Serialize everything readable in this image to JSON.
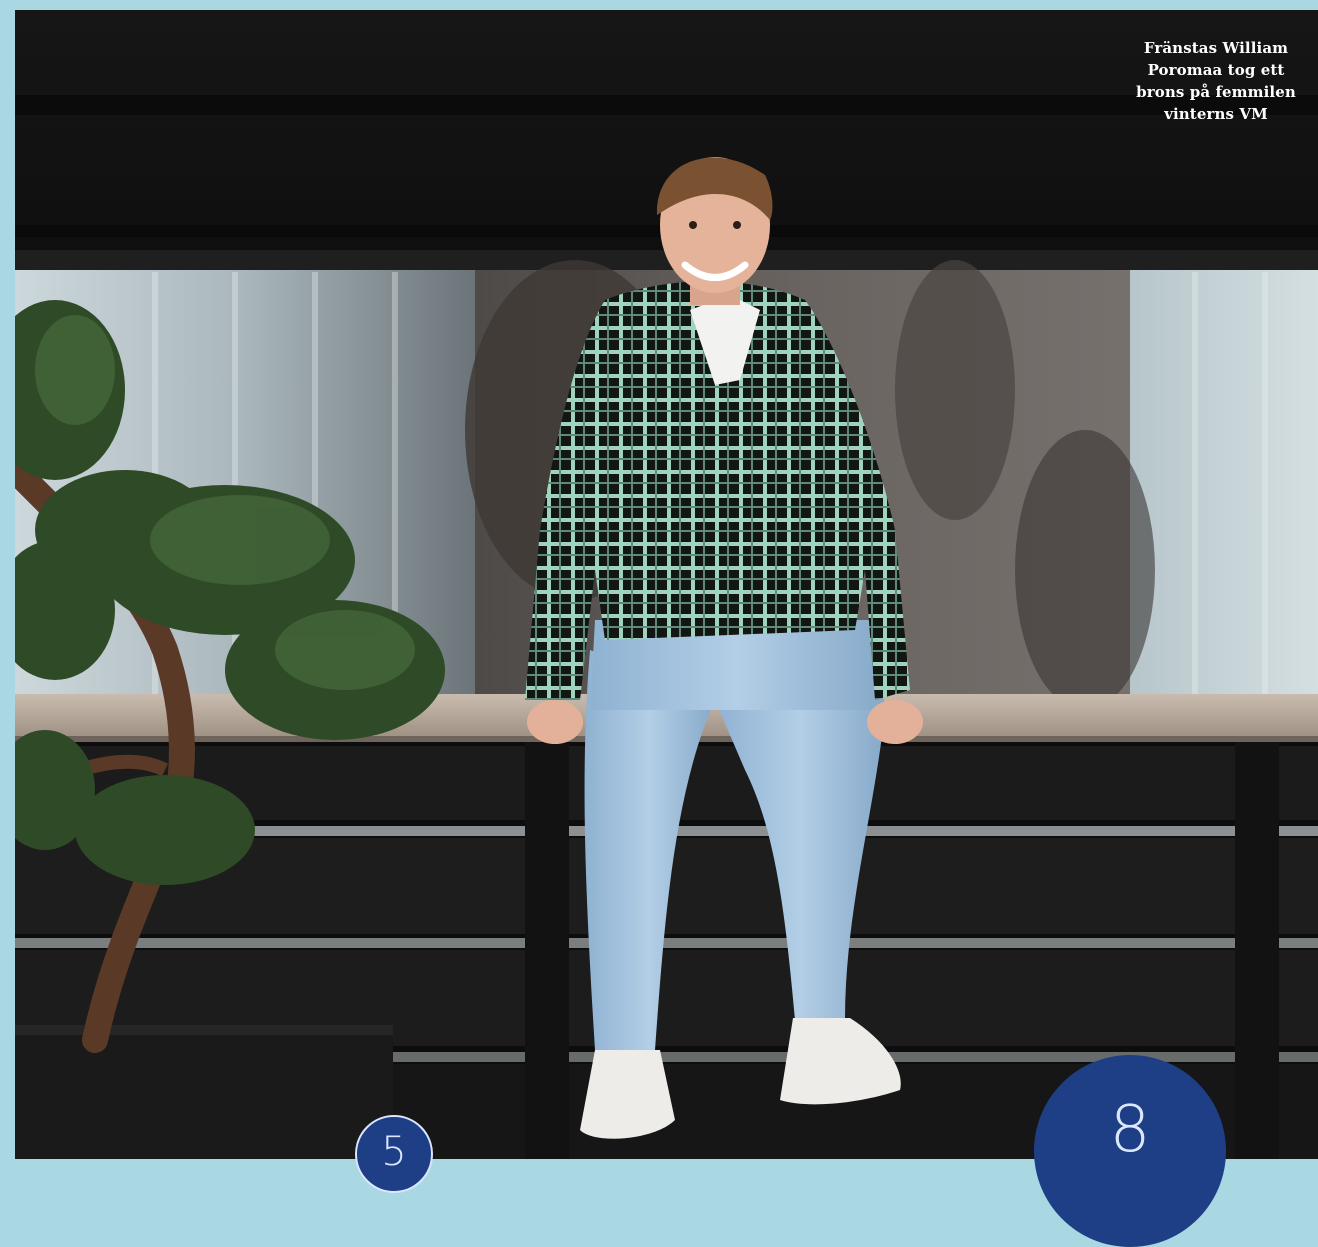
{
  "caption": {
    "line1": "Fränstas William",
    "line2": "Poromaa tog ett",
    "line3": "brons på femmilen",
    "line4": "vinterns VM"
  },
  "badges": {
    "left_number": "5",
    "right_number": "8"
  },
  "colors": {
    "page_border": "#a9d8e2",
    "badge_fill": "#1e3f86",
    "badge_text": "#dbe7ff"
  }
}
